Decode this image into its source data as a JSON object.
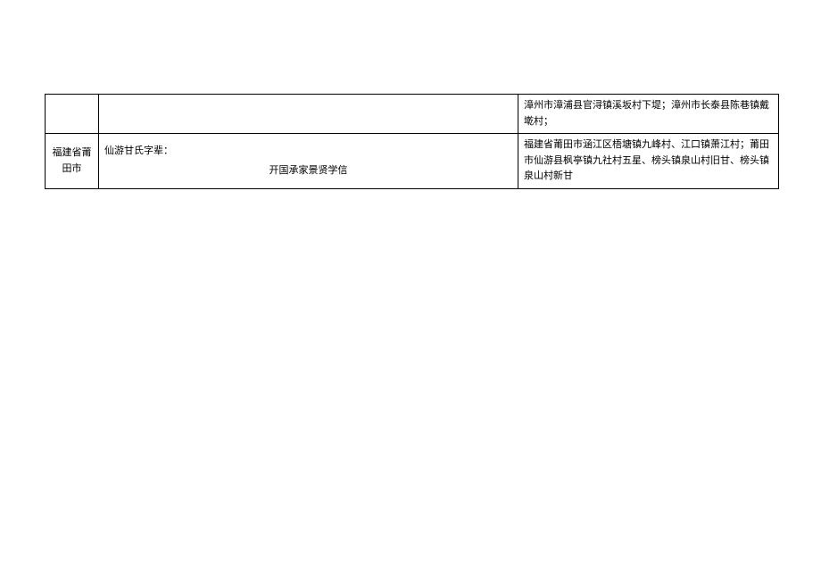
{
  "table": {
    "row1": {
      "region": "",
      "middle": "",
      "locations": "漳州市漳浦县官浔镇溪坂村下堤；漳州市长泰县陈巷镇戴墘村；"
    },
    "row2": {
      "region": "福建省莆田市",
      "ziabei_label": "仙游甘氏字辈：",
      "ziabei_content": "开国承家景贤学信",
      "locations": "福建省莆田市涵江区梧塘镇九峰村、江口镇萧江村；莆田市仙游县枫亭镇九社村五星、榜头镇泉山村旧甘、榜头镇泉山村新甘"
    }
  }
}
